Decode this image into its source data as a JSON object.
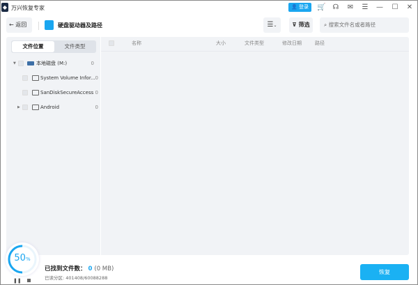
{
  "app": {
    "title": "万兴恢复专家",
    "login": "登录"
  },
  "toolbar": {
    "back": "返回",
    "breadcrumb": "硬盘驱动器及路径",
    "filter": "筛选",
    "search_placeholder": "搜索文件名或者路径"
  },
  "left": {
    "tabs": [
      "文件位置",
      "文件类型"
    ],
    "tree": [
      {
        "name": "本地磁盘 (M:)",
        "count": "0"
      },
      {
        "name": "System Volume Infor...",
        "count": "0"
      },
      {
        "name": "SanDiskSecureAccess",
        "count": "0"
      },
      {
        "name": "Android",
        "count": "0"
      }
    ]
  },
  "table": {
    "columns": [
      "名称",
      "大小",
      "文件类型",
      "修改日期",
      "路径"
    ]
  },
  "status": {
    "progress_percent": 50,
    "progress_num": "50",
    "progress_unit": "%",
    "found_label": "已找到文件数：",
    "found_count": "0",
    "found_size": "(0 MB)",
    "scanned": "已读分区: 401408/60088288",
    "recover": "恢复"
  },
  "colors": {
    "accent": "#1aa6f0"
  }
}
